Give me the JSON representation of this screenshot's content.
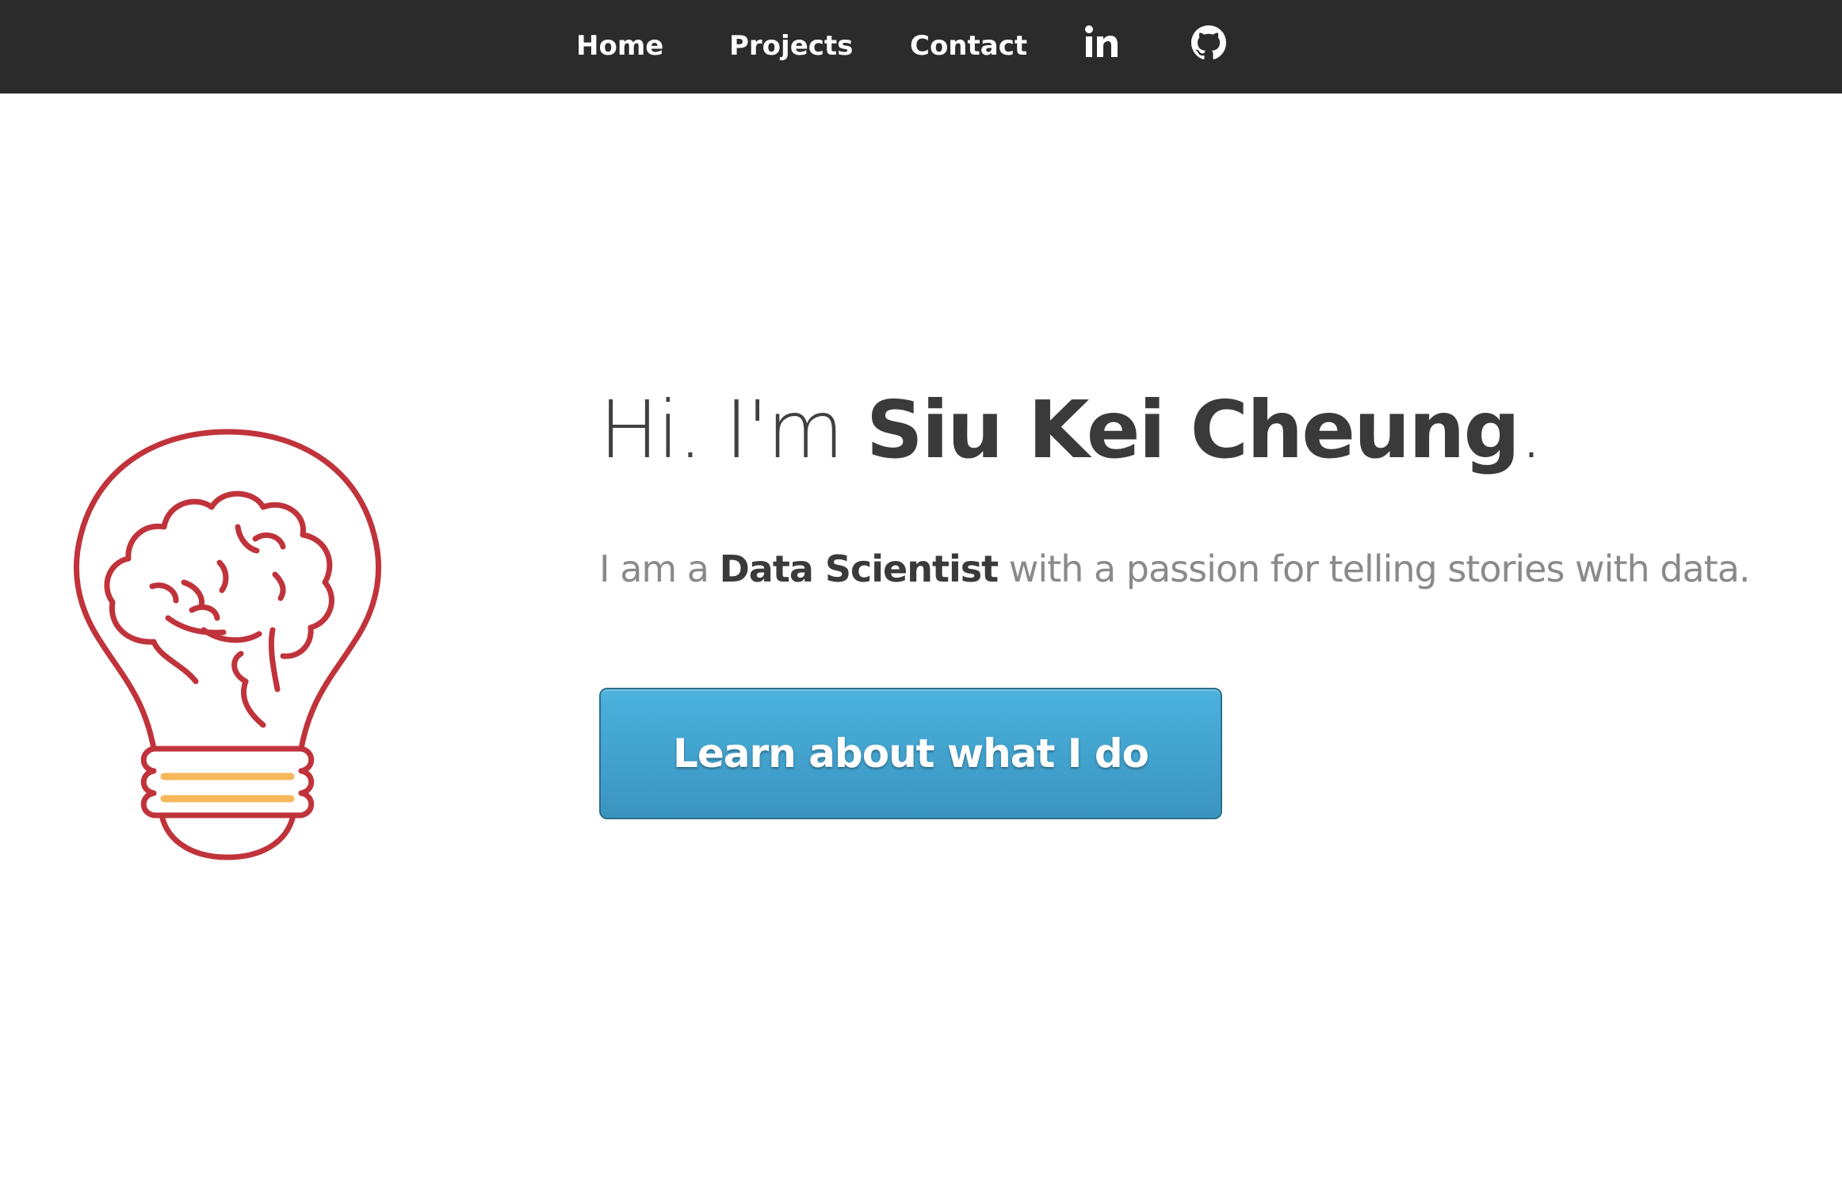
{
  "nav": {
    "home": "Home",
    "projects": "Projects",
    "contact": "Contact",
    "linkedin_icon": "linkedin-icon",
    "github_icon": "github-icon"
  },
  "hero": {
    "greeting": "Hi. I'm ",
    "name": "Siu Kei Cheung",
    "name_suffix": ".",
    "tagline_pre": "I am a ",
    "tagline_role": "Data Scientist",
    "tagline_post": " with a passion for telling stories with data.",
    "cta_label": "Learn about what I do"
  },
  "colors": {
    "nav_bg": "#2b2b2b",
    "bulb_outline": "#c0333b",
    "bulb_base_lines": "#f6b85a",
    "cta_bg": "#3fa3cf"
  }
}
